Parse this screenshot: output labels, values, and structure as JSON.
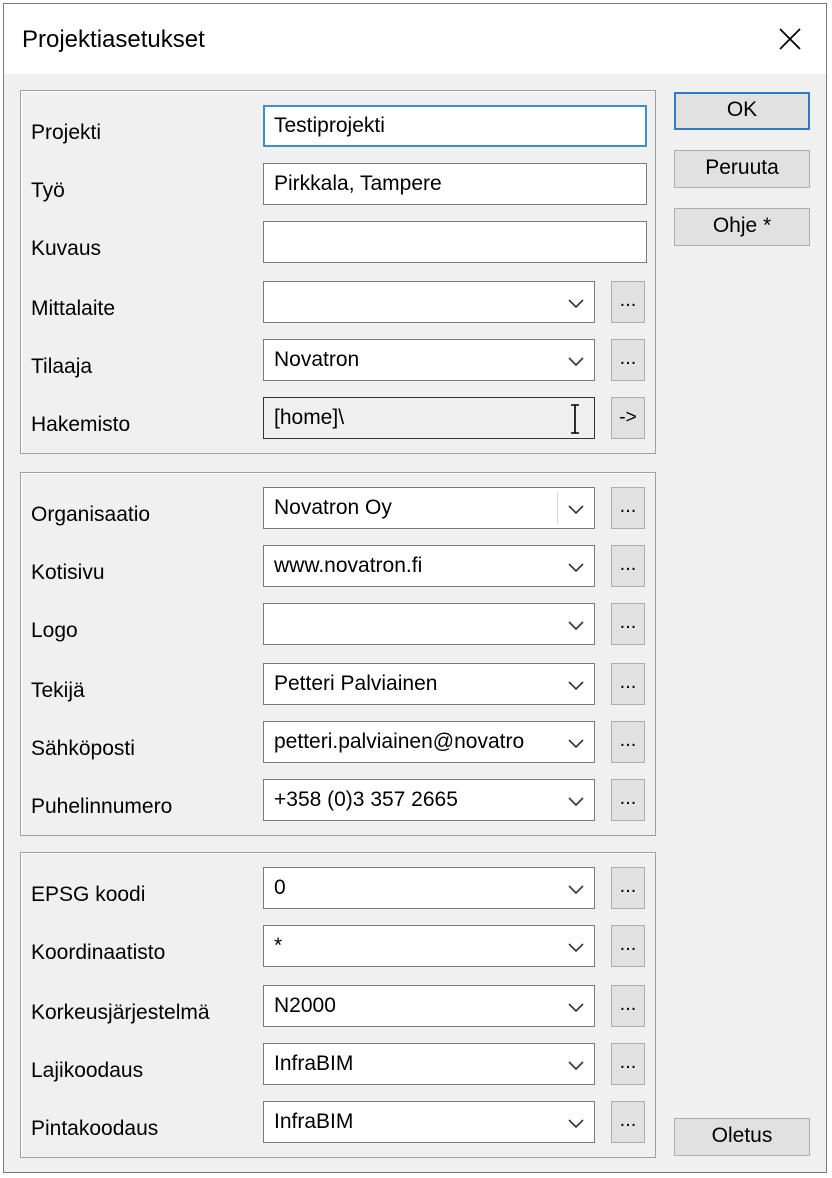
{
  "window": {
    "title": "Projektiasetukset"
  },
  "buttons": {
    "ok": "OK",
    "cancel": "Peruuta",
    "help": "Ohje *",
    "defaults": "Oletus",
    "ellipsis": "...",
    "arrow": "->"
  },
  "project": {
    "projekti_label": "Projekti",
    "projekti_value": "Testiprojekti",
    "tyo_label": "Työ",
    "tyo_value": "Pirkkala, Tampere",
    "kuvaus_label": "Kuvaus",
    "kuvaus_value": "",
    "mittalaite_label": "Mittalaite",
    "mittalaite_value": "",
    "tilaaja_label": "Tilaaja",
    "tilaaja_value": "Novatron",
    "hakemisto_label": "Hakemisto",
    "hakemisto_value": "[home]\\"
  },
  "organization": {
    "organisaatio_label": "Organisaatio",
    "organisaatio_value": "Novatron Oy",
    "kotisivu_label": "Kotisivu",
    "kotisivu_value": "www.novatron.fi",
    "logo_label": "Logo",
    "logo_value": "",
    "tekija_label": "Tekijä",
    "tekija_value": "Petteri Palviainen",
    "sahkoposti_label": "Sähköposti",
    "sahkoposti_value": "petteri.palviainen@novatro",
    "puhelin_label": "Puhelinnumero",
    "puhelin_value": "+358 (0)3 357 2665"
  },
  "coordinates": {
    "epsg_label": "EPSG koodi",
    "epsg_value": "0",
    "koordinaatisto_label": "Koordinaatisto",
    "koordinaatisto_value": "*",
    "korkeus_label": "Korkeusjärjestelmä",
    "korkeus_value": "N2000",
    "lajikoodaus_label": "Lajikoodaus",
    "lajikoodaus_value": "InfraBIM",
    "pintakoodaus_label": "Pintakoodaus",
    "pintakoodaus_value": "InfraBIM"
  },
  "icons": {
    "close": "close-icon",
    "dropdown": "chevron-down-icon",
    "text_cursor": "text-cursor-icon"
  },
  "colors": {
    "focus": "#3d8fd3",
    "default_button": "#2f7bc5"
  }
}
